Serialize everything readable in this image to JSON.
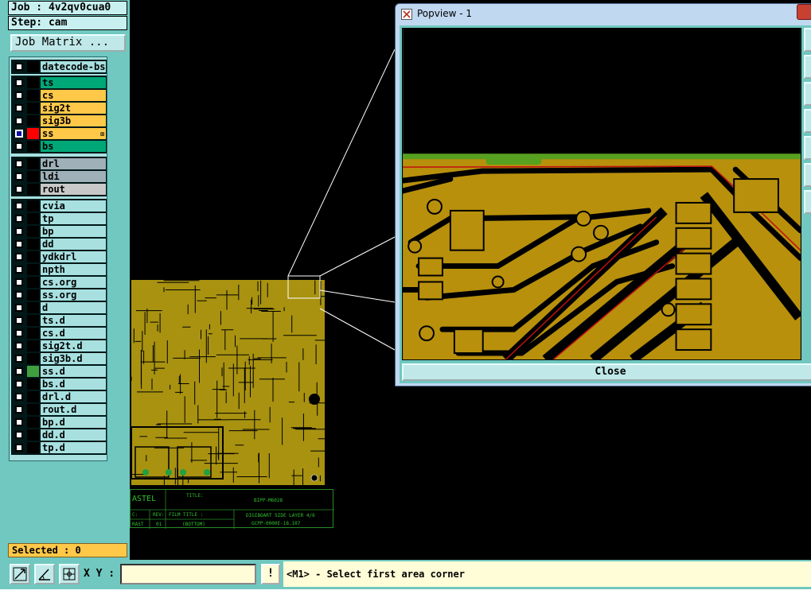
{
  "job": {
    "job_label": "Job : 4v2qv0cua0",
    "step_label": "Step: cam"
  },
  "job_matrix_button": "Job Matrix ...",
  "colors": {
    "board_base": "#b09a10",
    "green": "#00a878",
    "orange": "#ffc848",
    "gray": "#a0b0b8",
    "light_gray": "#c8c8c8",
    "cyan": "#a8e0e0",
    "red_select": "#ff0000"
  },
  "layers": [
    {
      "name": "datecode-bs",
      "color": "#000000",
      "fill": "#a8e0e0"
    },
    {
      "name": "ts",
      "color": "#000000",
      "fill": "#00a878"
    },
    {
      "name": "cs",
      "color": "#000000",
      "fill": "#ffc848"
    },
    {
      "name": "sig2t",
      "color": "#000000",
      "fill": "#ffc848"
    },
    {
      "name": "sig3b",
      "color": "#000000",
      "fill": "#ffc848"
    },
    {
      "name": "ss",
      "color": "#ff0000",
      "fill": "#ffc848",
      "selected": true,
      "mark": "⊞"
    },
    {
      "name": "bs",
      "color": "#000000",
      "fill": "#00a878"
    },
    {
      "name": "drl",
      "color": "#000000",
      "fill": "#a0b0b8"
    },
    {
      "name": "ldi",
      "color": "#000000",
      "fill": "#a0b0b8"
    },
    {
      "name": "rout",
      "color": "#000000",
      "fill": "#c8c8c8"
    },
    {
      "name": "cvia",
      "color": "#000000",
      "fill": "#a8e0e0"
    },
    {
      "name": "tp",
      "color": "#000000",
      "fill": "#a8e0e0"
    },
    {
      "name": "bp",
      "color": "#000000",
      "fill": "#a8e0e0"
    },
    {
      "name": "dd",
      "color": "#000000",
      "fill": "#a8e0e0"
    },
    {
      "name": "ydkdrl",
      "color": "#000000",
      "fill": "#a8e0e0"
    },
    {
      "name": "npth",
      "color": "#000000",
      "fill": "#a8e0e0"
    },
    {
      "name": "cs.org",
      "color": "#000000",
      "fill": "#a8e0e0"
    },
    {
      "name": "ss.org",
      "color": "#000000",
      "fill": "#a8e0e0"
    },
    {
      "name": "d",
      "color": "#000000",
      "fill": "#a8e0e0"
    },
    {
      "name": "ts.d",
      "color": "#000000",
      "fill": "#a8e0e0"
    },
    {
      "name": "cs.d",
      "color": "#000000",
      "fill": "#a8e0e0"
    },
    {
      "name": "sig2t.d",
      "color": "#000000",
      "fill": "#a8e0e0"
    },
    {
      "name": "sig3b.d",
      "color": "#000000",
      "fill": "#a8e0e0"
    },
    {
      "name": "ss.d",
      "color": "#40a040",
      "fill": "#a8e0e0"
    },
    {
      "name": "bs.d",
      "color": "#000000",
      "fill": "#a8e0e0"
    },
    {
      "name": "drl.d",
      "color": "#000000",
      "fill": "#a8e0e0"
    },
    {
      "name": "rout.d",
      "color": "#000000",
      "fill": "#a8e0e0"
    },
    {
      "name": "bp.d",
      "color": "#000000",
      "fill": "#a8e0e0"
    },
    {
      "name": "dd.d",
      "color": "#000000",
      "fill": "#a8e0e0"
    },
    {
      "name": "tp.d",
      "color": "#000000",
      "fill": "#a8e0e0"
    }
  ],
  "selected_label": "Selected : 0",
  "xy_label": "X Y :",
  "xy_input_value": "",
  "alert_label": "!",
  "prompt_text": "<M1> - Select first area corner",
  "coord_readout": "...",
  "popview": {
    "title": "Popview - 1",
    "close_label": "Close"
  },
  "title_block": {
    "brand": "ASTEL",
    "title_label": "TITLE:",
    "title_value": "BIPP-M6028",
    "rev_label": "REV:",
    "rev_value": "01",
    "film_title_label": "FILM TITLE :",
    "film_title_value": "(BOTTOM)",
    "desc_line1": "DIGIBOART SIDE LAYER 4/6",
    "desc_line2": "GCPP-0000E-18.107",
    "left_label1": "C:",
    "left_label2": "RAST"
  }
}
